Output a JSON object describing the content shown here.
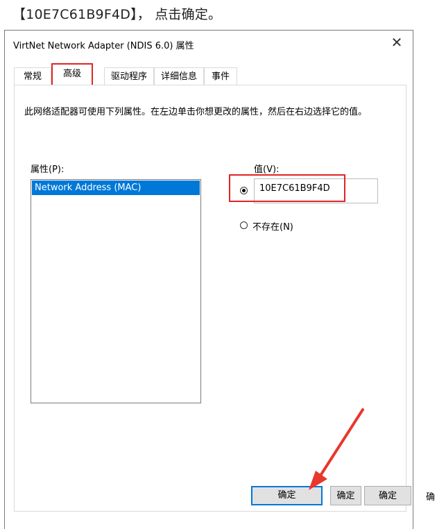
{
  "caption": "【10E7C61B9F4D】， 点击确定。",
  "dialog": {
    "title": "VirtNet Network Adapter (NDIS 6.0) 属性",
    "close_glyph": "✕",
    "tabs": [
      {
        "label": "常规",
        "active": false
      },
      {
        "label": "高级",
        "active": true
      },
      {
        "label": "驱动程序",
        "active": false
      },
      {
        "label": "详细信息",
        "active": false
      },
      {
        "label": "事件",
        "active": false
      }
    ],
    "description": "此网络适配器可使用下列属性。在左边单击你想更改的属性，然后在右边选择它的值。",
    "property_label": "属性(P):",
    "property_items": [
      "Network Address (MAC)"
    ],
    "value_label": "值(V):",
    "value_input": "10E7C61B9F4D",
    "not_present_label": "不存在(N)",
    "buttons": {
      "ok": "确定",
      "ok2": "确定",
      "ok3": "确定",
      "cut_glyph": "确"
    }
  },
  "colors": {
    "highlight_red": "#e02424",
    "selection_blue": "#0078d7",
    "arrow_red": "#e8372c"
  },
  "icons": {
    "close": "close-icon",
    "radio_checked": "radio-checked-icon",
    "radio_unchecked": "radio-unchecked-icon",
    "arrow": "red-arrow-annotation"
  }
}
